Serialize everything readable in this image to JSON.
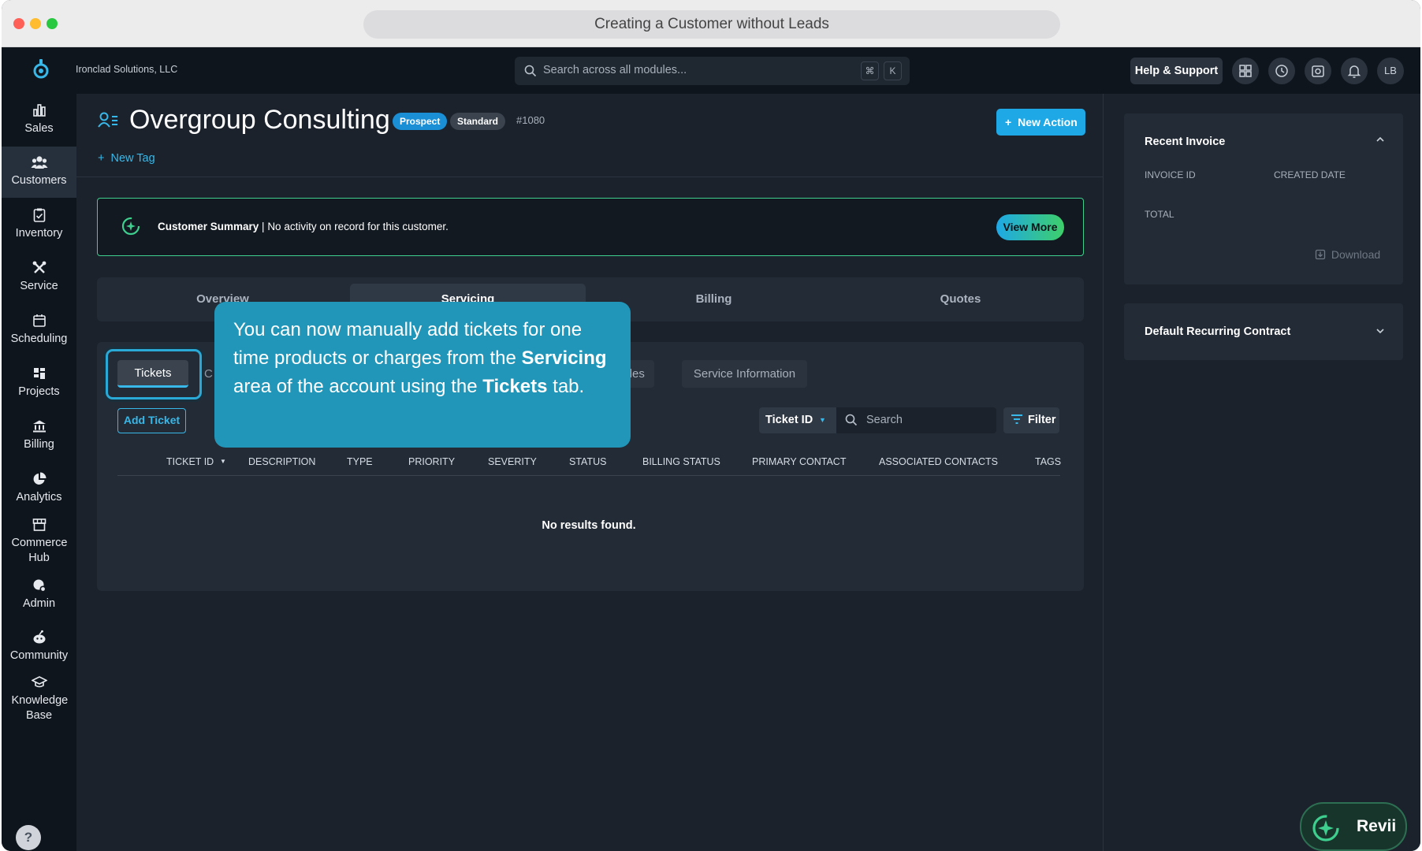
{
  "browser": {
    "title": "Creating a Customer without Leads"
  },
  "topnav": {
    "company": "Ironclad Solutions, LLC",
    "search_placeholder": "Search across all modules...",
    "shortcut_cmd": "⌘",
    "shortcut_key": "K",
    "help_label": "Help & Support",
    "avatar_initials": "LB"
  },
  "sidebar": {
    "items": [
      {
        "label": "Sales",
        "icon": "bar-chart-icon"
      },
      {
        "label": "Customers",
        "icon": "users-icon",
        "active": true
      },
      {
        "label": "Inventory",
        "icon": "clipboard-icon"
      },
      {
        "label": "Service",
        "icon": "tools-icon"
      },
      {
        "label": "Scheduling",
        "icon": "calendar-icon"
      },
      {
        "label": "Projects",
        "icon": "projects-icon"
      },
      {
        "label": "Billing",
        "icon": "bank-icon"
      },
      {
        "label": "Analytics",
        "icon": "pie-chart-icon"
      },
      {
        "label": "Commerce Hub",
        "icon": "store-icon"
      },
      {
        "label": "Admin",
        "icon": "admin-icon"
      },
      {
        "label": "Community",
        "icon": "community-icon"
      },
      {
        "label": "Knowledge Base",
        "icon": "graduation-cap-icon"
      }
    ],
    "help_glyph": "?"
  },
  "customer": {
    "name": "Overgroup Consulting",
    "status_badge": "Prospect",
    "tier_badge": "Standard",
    "number": "#1080",
    "new_tag_label": "New Tag",
    "new_action_label": "New Action"
  },
  "summary": {
    "title": "Customer Summary",
    "separator": " | ",
    "text": "No activity on record for this customer.",
    "view_more_label": "View More"
  },
  "main_tabs": [
    "Overview",
    "Servicing",
    "Billing",
    "Quotes"
  ],
  "sub_tabs": {
    "tickets": "Tickets",
    "partial_c": "C",
    "partial_modules": "dules",
    "service_info": "Service Information"
  },
  "tickets": {
    "add_label": "Add Ticket",
    "sort_field": "Ticket ID",
    "search_placeholder": "Search",
    "filter_label": "Filter",
    "columns": [
      "TICKET ID",
      "DESCRIPTION",
      "TYPE",
      "PRIORITY",
      "SEVERITY",
      "STATUS",
      "BILLING STATUS",
      "PRIMARY CONTACT",
      "ASSOCIATED CONTACTS",
      "TAGS"
    ],
    "empty_text": "No results found."
  },
  "right_panel": {
    "recent_invoice_title": "Recent Invoice",
    "invoice_id_label": "INVOICE ID",
    "created_date_label": "CREATED DATE",
    "total_label": "TOTAL",
    "download_label": "Download",
    "contract_title": "Default Recurring Contract"
  },
  "tooltip": {
    "part1": "You can now manually add tickets for one time products or charges from the ",
    "bold1": "Servicing",
    "part2": " area of the account using the ",
    "bold2": "Tickets",
    "part3": " tab."
  },
  "assistant": {
    "label": "Revii"
  },
  "colors": {
    "accent": "#1ea8e6",
    "tooltip_bg": "#2196b8",
    "prospect_badge": "#1a8fd6",
    "summary_border": "#3ecf8e",
    "view_more_gradient_start": "#1ea8e6",
    "view_more_gradient_end": "#3ecf6a"
  }
}
